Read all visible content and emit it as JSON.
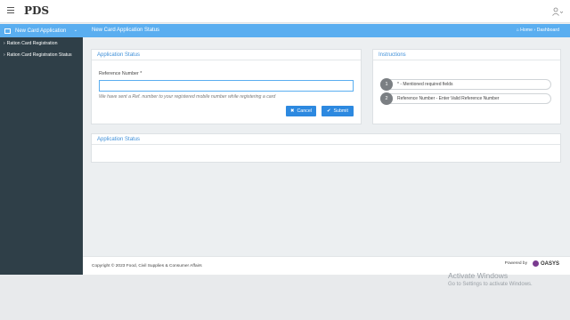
{
  "app": {
    "brand": "PDS"
  },
  "sidebar": {
    "active": "New Card Application",
    "items": [
      {
        "label": "Ration Card Registration"
      },
      {
        "label": "Ration Card Registration Status"
      }
    ]
  },
  "header": {
    "title": "New Card Application Status",
    "breadcrumb_home": "Home",
    "breadcrumb_current": "Dashboard"
  },
  "form_panel": {
    "title": "Application Status",
    "field_label": "Reference Number *",
    "field_value": "",
    "hint": "We have sent a Ref. number to your registered mobile number while registering a card",
    "cancel_label": "Cancel",
    "submit_label": "Submit"
  },
  "instructions": {
    "title": "Instructions",
    "steps": [
      {
        "num": "1",
        "text": "* - Mentioned required fields"
      },
      {
        "num": "2",
        "text": "Reference Number - Enter Valid Reference Number"
      }
    ]
  },
  "status_panel": {
    "title": "Application Status"
  },
  "footer": {
    "copyright": "Copyright © 2023 Food, Civil Supplies & Consumer Affairs",
    "powered_by": "Powered by",
    "logo_text": "OASYS"
  },
  "watermark": {
    "line1": "Activate Windows",
    "line2": "Go to Settings to activate Windows."
  },
  "colors": {
    "accent": "#5aaef0",
    "sidebar": "#2f3f48",
    "button": "#2d89e0"
  }
}
